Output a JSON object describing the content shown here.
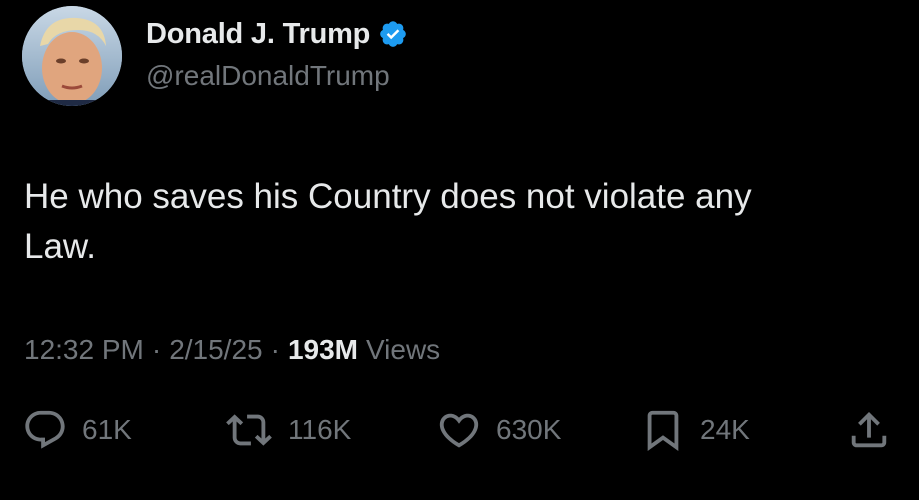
{
  "author": {
    "name": "Donald J. Trump",
    "handle": "@realDonaldTrump",
    "verified_icon": "verified-badge-icon"
  },
  "tweet": {
    "text": "He who saves his Country does not violate any\nLaw."
  },
  "meta": {
    "time": "12:32 PM",
    "date": "2/15/25",
    "separator": "·",
    "views_count": "193M",
    "views_label": "Views"
  },
  "actions": {
    "replies": "61K",
    "reposts": "116K",
    "likes": "630K",
    "bookmarks": "24K"
  },
  "colors": {
    "background": "#000000",
    "primary_text": "#e7e9ea",
    "secondary_text": "#71767b",
    "verified_blue": "#1d9bf0"
  }
}
